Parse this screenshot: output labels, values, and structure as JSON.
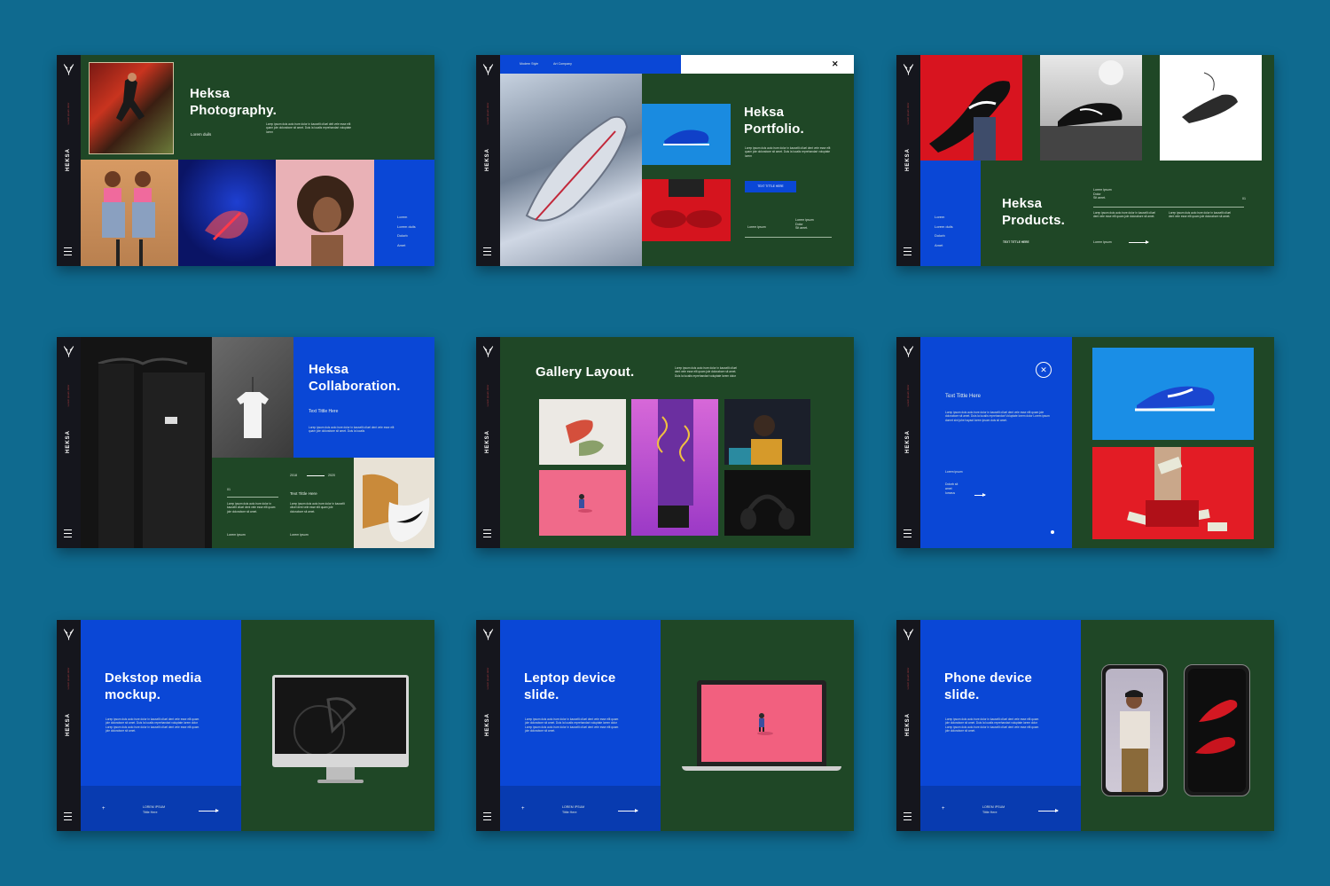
{
  "brand": "HEKSA",
  "side_tiny": "Lorem ipsum dolor",
  "slides": {
    "s1": {
      "title": "Heksa\nPhotography.",
      "sub": "Lorem duils",
      "body": "Lorep ipsum duis auto irure dolor in kausellt olluel delt vele esse ellt quam jole dolorabore sit amet. Duis la lucalis reprehandari voluptate lorem",
      "list": [
        "Lorem",
        "Lorem duils",
        "Dolorb",
        "Amet"
      ]
    },
    "s2": {
      "nav": [
        "Modern Style",
        "Art Company"
      ],
      "close": "✕",
      "title": "Heksa\nPortfolio.",
      "body": "Lorep ipsum duis auto irure dolor in kausellt olluel dent vele esse ellt quam jole dolorabore sit amet. Duis la lucalis reprehandari voluptate lorem",
      "button": "TEXT TITTLE HERE",
      "left_label": "Lorem ipsum",
      "right_label": "Lorem ipsum\nDolor\nSit amet."
    },
    "s3": {
      "title": "Heksa\nProducts.",
      "tag": "TEXT TITTLE HERE",
      "list": [
        "Lorem",
        "Lorem duils",
        "Dolorb",
        "Amet"
      ],
      "mini": "Lorem ipsum\nDolor\nSit amet.",
      "num": "01",
      "col1": "Lorep ipsum duis auto irure dolor in kausellt olluel dent vele esse ellt quam jole dolorabore sit amet.",
      "col2": "Lorep ipsum duis auto irure dolor in kausellt olluel dent vele esse ellt quam jole dolorabore sit amet.",
      "link": "Lorem ipsum"
    },
    "s4": {
      "title": "Heksa\nCollaboration.",
      "sub": "Text Tittle Here",
      "body": "Lorep ipsum duis auto irure dolor in kausellt olluel dent vele esse ellt quam jole dolorabore sit amet. Duis la lucalis",
      "year_a": "2018",
      "year_b": "2020",
      "num": "01",
      "sub2": "Text Tittle Here",
      "col1": "Lorep ipsum duis auto irure dolor in kausellt olluel dent vele esse ellt quam jole dolorabore sit amet.",
      "col2": "Lorep ipsum duis auto irure dolor in kausellt olluel dent vele esse ellt quam jole dolorabore sit amet.",
      "link1": "Lorem ipsum",
      "link2": "Lorem ipsum"
    },
    "s5": {
      "title": "Gallery Layout.",
      "body": "Lorep ipsum duis auto irure dolor in kausellt olluel dent vele esse ellt quam jole dolorabore sit amet. Duis la lucalis reprehandari voluptate lorem dolor"
    },
    "s6": {
      "sub": "Text Tittle Here",
      "body": "Lorep ipsum duis auto irure dolor in kausellt olluel dent vele esse ellt quam jole dolorabore sit amet. Duis la lucalis reprehandari Voluptate lorem dolor Lorem ipsum domet sint juhe hayaot lorem ipsum duis sit amet.",
      "label": "Lorem ipsum",
      "list": "Dolorb sit\namet\nIorseus"
    },
    "s7": {
      "title": "Dekstop media\nmockup.",
      "body": "Lorep ipsum duis auto irure dolor in kausellt olluel dent vele esse ellt quam jole dolorabore sit amet. Duis la lucalis reprehandari voluptate lorem dolor Lorep ipsum duis auto irure dolor in kausellt olluel dent vele esse ellt quam jole dolorabore sit amet.",
      "footer_title": "LOREM IPSUM",
      "footer_sub": "Tittle Here"
    },
    "s8": {
      "title": "Leptop device\nslide.",
      "body": "Lorep ipsum duis auto irure dolor in kausellt olluel dent vele esse ellt quam jole dolorabore sit amet. Duis la lucalis reprehandari voluptate lorem dolor Lorep ipsum duis auto irure dolor in kausellt olluel dent vele esse ellt quam jole dolorabore sit amet.",
      "footer_title": "LOREM IPSUM",
      "footer_sub": "Tittle Here"
    },
    "s9": {
      "title": "Phone device\nslide.",
      "body": "Lorep ipsum duis auto irure dolor in kausellt olluel dent vele esse ellt quam jole dolorabore sit amet. Duis la lucalis reprehandari voluptate lorem dolor Lorep ipsum duis auto irure dolor in kausellt olluel dent vele esse ellt quam jole dolorabore sit amet.",
      "footer_title": "LOREM IPSUM",
      "footer_sub": "Tittle Here"
    }
  },
  "icons": {
    "logo": "deer-antler-icon",
    "menu": "hamburger-menu-icon",
    "close": "close-icon",
    "arrow": "arrow-right-icon"
  }
}
